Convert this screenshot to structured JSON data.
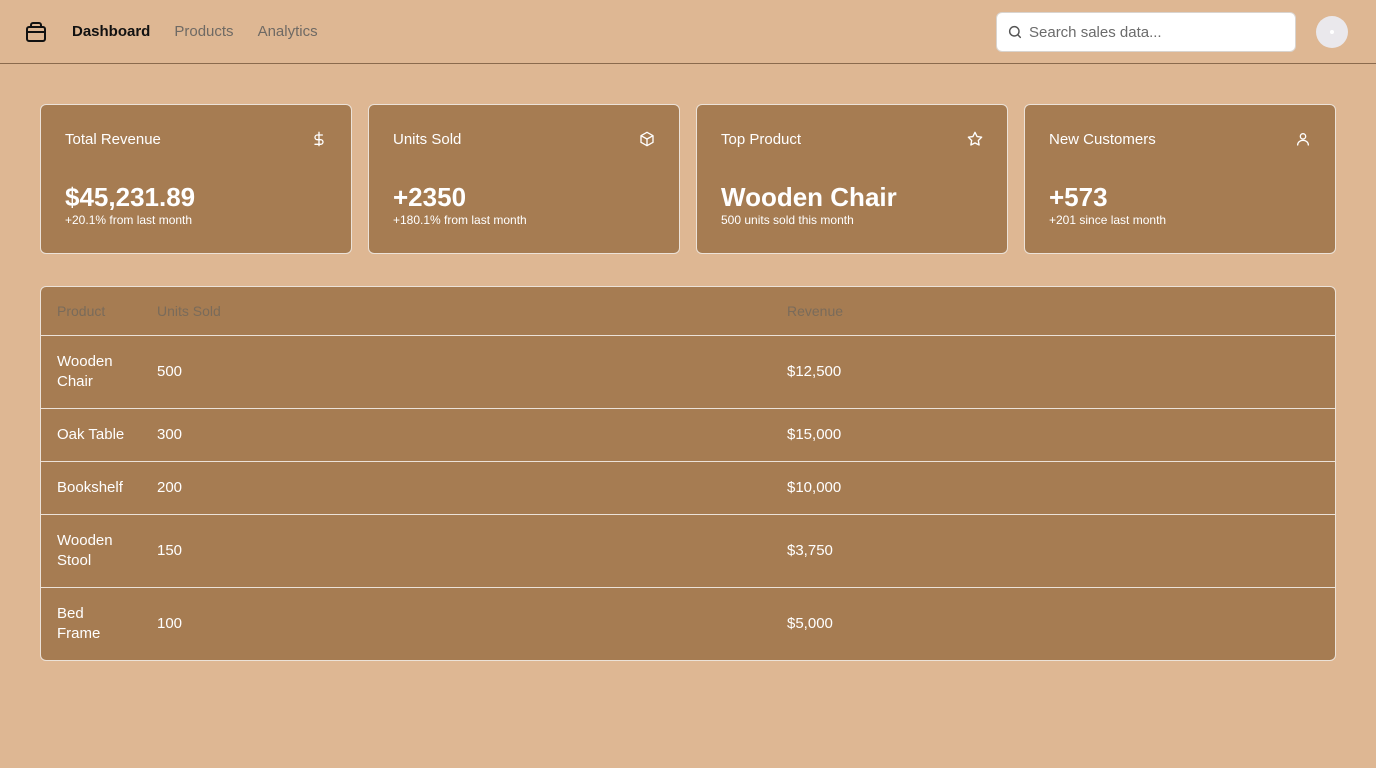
{
  "nav": {
    "items": [
      {
        "label": "Dashboard",
        "active": true
      },
      {
        "label": "Products",
        "active": false
      },
      {
        "label": "Analytics",
        "active": false
      }
    ]
  },
  "search": {
    "placeholder": "Search sales data...",
    "value": ""
  },
  "cards": [
    {
      "title": "Total Revenue",
      "icon": "dollar-icon",
      "value": "$45,231.89",
      "sub": "+20.1% from last month"
    },
    {
      "title": "Units Sold",
      "icon": "box-icon",
      "value": "+2350",
      "sub": "+180.1% from last month"
    },
    {
      "title": "Top Product",
      "icon": "star-icon",
      "value": "Wooden Chair",
      "sub": "500 units sold this month"
    },
    {
      "title": "New Customers",
      "icon": "user-icon",
      "value": "+573",
      "sub": "+201 since last month"
    }
  ],
  "table": {
    "columns": [
      "Product",
      "Units Sold",
      "Revenue"
    ],
    "rows": [
      {
        "product": "Wooden Chair",
        "units": "500",
        "revenue": "$12,500"
      },
      {
        "product": "Oak Table",
        "units": "300",
        "revenue": "$15,000"
      },
      {
        "product": "Bookshelf",
        "units": "200",
        "revenue": "$10,000"
      },
      {
        "product": "Wooden Stool",
        "units": "150",
        "revenue": "$3,750"
      },
      {
        "product": "Bed Frame",
        "units": "100",
        "revenue": "$5,000"
      }
    ]
  },
  "colors": {
    "background": "#deb793",
    "card": "#a67c52",
    "card_border": "#ece2d8",
    "header_text_muted": "#7a6b5a"
  }
}
